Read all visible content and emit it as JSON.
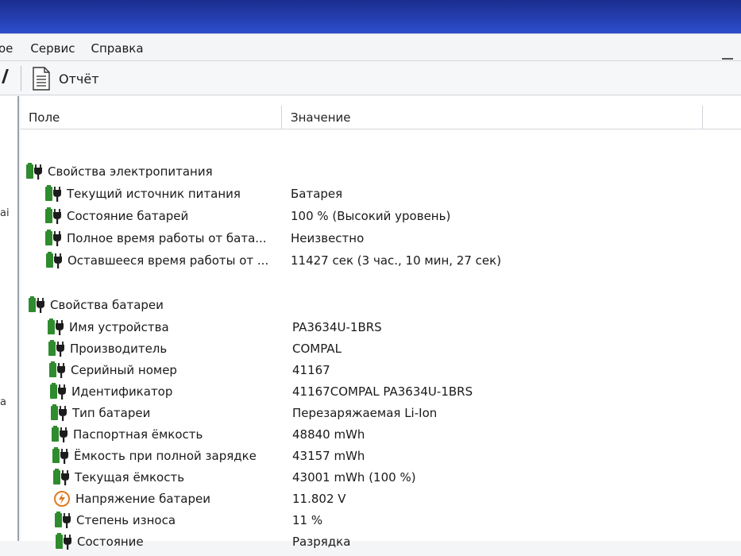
{
  "menu": {
    "items": [
      {
        "label": "ое"
      },
      {
        "label": "Сервис"
      },
      {
        "label": "Справка"
      }
    ]
  },
  "toolbar": {
    "report_label": "Отчёт",
    "report_icon": "document-icon"
  },
  "left_pane": {
    "fragments": [
      "ai",
      "a"
    ]
  },
  "columns": {
    "field": "Поле",
    "value": "Значение"
  },
  "sections": [
    {
      "title": "Свойства электропитания",
      "icon": "battery-plug-icon",
      "rows": [
        {
          "field": "Текущий источник питания",
          "value": "Батарея",
          "icon": "battery-plug-icon"
        },
        {
          "field": "Состояние батарей",
          "value": "100 % (Высокий уровень)",
          "icon": "battery-plug-icon"
        },
        {
          "field": "Полное время работы от бата...",
          "value": "Неизвестно",
          "icon": "battery-plug-icon"
        },
        {
          "field": "Оставшееся время работы от ...",
          "value": "11427 сек (3 час., 10 мин, 27 сек)",
          "icon": "battery-plug-icon"
        }
      ]
    },
    {
      "title": "Свойства батареи",
      "icon": "battery-plug-icon",
      "rows": [
        {
          "field": "Имя устройства",
          "value": "PA3634U-1BRS",
          "icon": "battery-plug-icon"
        },
        {
          "field": "Производитель",
          "value": "COMPAL",
          "icon": "battery-plug-icon"
        },
        {
          "field": "Серийный номер",
          "value": "41167",
          "icon": "battery-plug-icon"
        },
        {
          "field": "Идентификатор",
          "value": "41167COMPAL PA3634U-1BRS",
          "icon": "battery-plug-icon"
        },
        {
          "field": "Тип батареи",
          "value": "Перезаряжаемая Li-Ion",
          "icon": "battery-plug-icon"
        },
        {
          "field": "Паспортная ёмкость",
          "value": "48840 mWh",
          "icon": "battery-plug-icon"
        },
        {
          "field": "Ёмкость при полной зарядке",
          "value": "43157 mWh",
          "icon": "battery-plug-icon"
        },
        {
          "field": "Текущая ёмкость",
          "value": "43001 mWh  (100 %)",
          "icon": "battery-plug-icon"
        },
        {
          "field": "Напряжение батареи",
          "value": "11.802 V",
          "icon": "voltage-icon"
        },
        {
          "field": "Степень износа",
          "value": "11 %",
          "icon": "battery-plug-icon"
        },
        {
          "field": "Состояние",
          "value": "Разрядка",
          "icon": "battery-plug-icon"
        }
      ]
    }
  ],
  "colors": {
    "battery_green": "#2e8b2e",
    "plug_dark": "#1c1c1c",
    "voltage_orange": "#e07a1f"
  }
}
